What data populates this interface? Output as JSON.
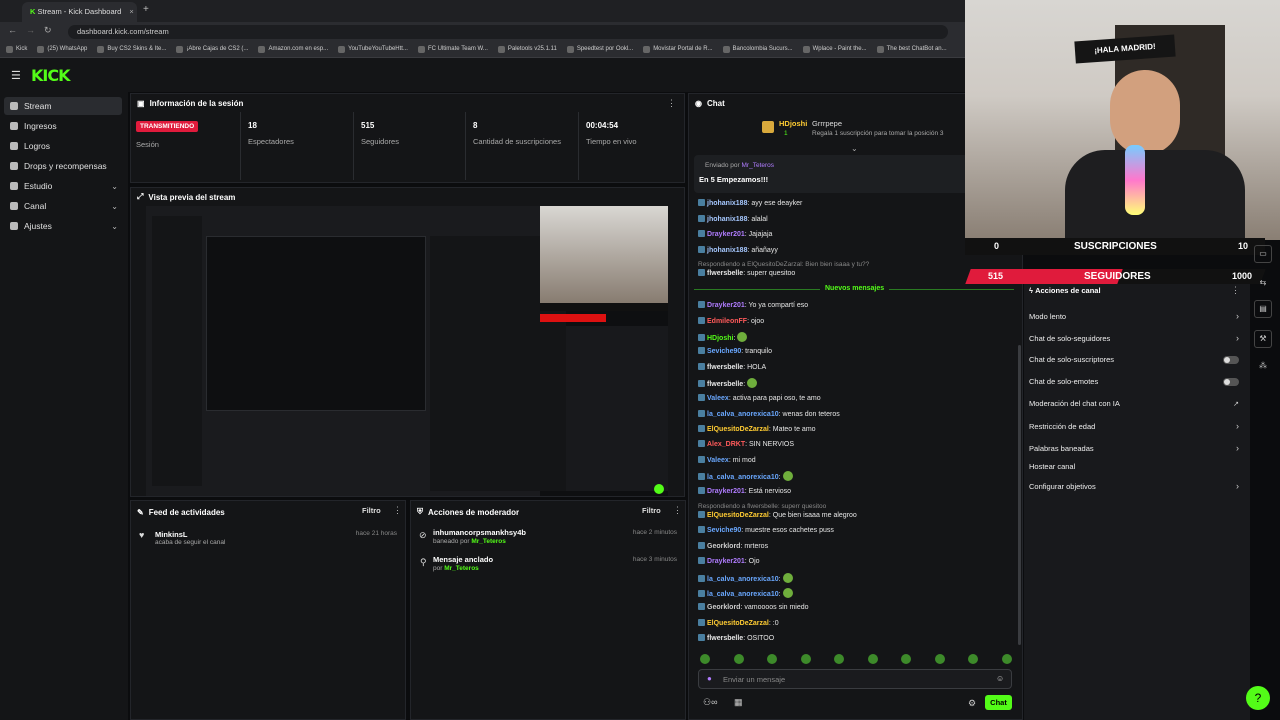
{
  "browser": {
    "tab_title": "Stream - Kick Dashboard",
    "url": "dashboard.kick.com/stream",
    "bookmarks": [
      "Kick",
      "(25) WhatsApp",
      "Buy CS2 Skins & Ite...",
      "¡Abre Cajas de CS2 (...",
      "Amazon.com en esp...",
      "YouTubeYouTubeHtt...",
      "FC Ultimate Team W...",
      "Paletools v25.1.11",
      "Speedtest por Ookl...",
      "Movistar Portal de R...",
      "Bancolombia Sucurs...",
      "Wplace - Paint the...",
      "The best ChatBot an..."
    ]
  },
  "logo": "KICK",
  "sidebar": [
    {
      "label": "Stream"
    },
    {
      "label": "Ingresos"
    },
    {
      "label": "Logros"
    },
    {
      "label": "Drops y recompensas"
    },
    {
      "label": "Estudio"
    },
    {
      "label": "Canal"
    },
    {
      "label": "Ajustes"
    }
  ],
  "session": {
    "title": "Información de la sesión",
    "live": "TRANSMITIENDO",
    "session_label": "Sesión",
    "stats": [
      {
        "value": "18",
        "label": "Espectadores"
      },
      {
        "value": "515",
        "label": "Seguidores"
      },
      {
        "value": "8",
        "label": "Cantidad de suscripciones"
      },
      {
        "value": "00:04:54",
        "label": "Tiempo en vivo"
      }
    ]
  },
  "preview": {
    "title": "Vista previa del stream"
  },
  "feed": {
    "title": "Feed de actividades",
    "filter": "Filtro",
    "user": "MinkinsL",
    "action": "acaba de seguir el canal",
    "time": "hace 21 horas"
  },
  "mod": {
    "title": "Acciones de moderador",
    "filter": "Filtro",
    "items": [
      {
        "title": "inhumancorpsmankhsy4b",
        "sub": "baneado por",
        "by": "Mr_Teteros",
        "time": "hace 2 minutos"
      },
      {
        "title": "Mensaje anclado",
        "sub": "por",
        "by": "Mr_Teteros",
        "time": "hace 3 minutos"
      }
    ]
  },
  "chat": {
    "title": "Chat",
    "top_user": "HDjoshi",
    "top_user2": "Grrrpepe",
    "top_count": "1",
    "sub_note": "Regala 1 suscripción para tomar la posición 3",
    "pinned_by": "Enviado por",
    "pinned_user": "Mr_Teteros",
    "pinned_msg": "En 5 Empezamos!!!",
    "new_divider": "Nuevos mensajes",
    "input_placeholder": "Enviar un mensaje",
    "send": "Chat",
    "messages": [
      {
        "user": "jhohanix188",
        "text": "ayy ese deayker",
        "color": "#a6c8ff"
      },
      {
        "user": "jhohanix188",
        "text": "alalal",
        "color": "#a6c8ff"
      },
      {
        "user": "Drayker201",
        "text": "Jajajaja",
        "color": "#b07cff"
      },
      {
        "user": "jhohanix188",
        "text": "añañayy",
        "color": "#a6c8ff"
      },
      {
        "user": "",
        "text": "Respondiendo a ElQuesitoDeZarzal: Bien bien isaaa y tu??",
        "color": "#888"
      },
      {
        "user": "flwersbelle",
        "text": "superr quesitoo",
        "color": "#e6e6e6"
      },
      {
        "user": "Drayker201",
        "text": "Yo ya compartí eso",
        "color": "#b07cff"
      },
      {
        "user": "EdmileonFF",
        "text": "ojoo",
        "color": "#ff5a5a"
      },
      {
        "user": "HDjoshi",
        "text": "",
        "color": "#53fc18"
      },
      {
        "user": "Seviche90",
        "text": "tranquilo",
        "color": "#6aa8ff"
      },
      {
        "user": "flwersbelle",
        "text": "HOLA",
        "color": "#e6e6e6"
      },
      {
        "user": "flwersbelle",
        "text": "",
        "color": "#e6e6e6"
      },
      {
        "user": "Valeex",
        "text": "activa para papi oso, te amo",
        "color": "#6aa8ff"
      },
      {
        "user": "la_calva_anorexica10",
        "text": "wenas don teteros",
        "color": "#6aa8ff"
      },
      {
        "user": "ElQuesitoDeZarzal",
        "text": "Mateo te amo",
        "color": "#ffcc33"
      },
      {
        "user": "Alex_DRKT",
        "text": "SIN NERVIOS",
        "color": "#ff5a5a"
      },
      {
        "user": "Valeex",
        "text": "mi mod",
        "color": "#6aa8ff"
      },
      {
        "user": "la_calva_anorexica10",
        "text": "",
        "color": "#6aa8ff"
      },
      {
        "user": "Drayker201",
        "text": "Está nervioso",
        "color": "#b07cff"
      },
      {
        "user": "",
        "text": "Respondiendo a flwersbelle: superr quesitoo",
        "color": "#888"
      },
      {
        "user": "ElQuesitoDeZarzal",
        "text": "Que bien isaaa me alegroo",
        "color": "#ffcc33"
      },
      {
        "user": "Seviche90",
        "text": "muestre esos cachetes puss",
        "color": "#6aa8ff"
      },
      {
        "user": "Georklord",
        "text": "mrteros",
        "color": "#ccc"
      },
      {
        "user": "Drayker201",
        "text": "Ojo",
        "color": "#b07cff"
      },
      {
        "user": "la_calva_anorexica10",
        "text": "",
        "color": "#6aa8ff"
      },
      {
        "user": "la_calva_anorexica10",
        "text": "",
        "color": "#6aa8ff"
      },
      {
        "user": "Georklord",
        "text": "vamoooos sin miedo",
        "color": "#ccc"
      },
      {
        "user": "ElQuesitoDeZarzal",
        "text": ":0",
        "color": "#ffcc33"
      },
      {
        "user": "flwersbelle",
        "text": "OSITOO",
        "color": "#e6e6e6"
      }
    ]
  },
  "overlay": {
    "subs_label": "SUSCRIPCIONES",
    "subs_value": "0",
    "subs_goal": "10",
    "subs_progress": 0,
    "followers_label": "SEGUIDORES",
    "followers_value": "515",
    "followers_goal": "1000",
    "followers_progress": 0.515
  },
  "actions": {
    "title": "Acciones de canal",
    "rows": [
      {
        "label": "Modo lento",
        "type": "chev"
      },
      {
        "label": "Chat de solo-seguidores",
        "type": "chev"
      },
      {
        "label": "Chat de solo-suscriptores",
        "type": "toggle"
      },
      {
        "label": "Chat de solo-emotes",
        "type": "toggle"
      },
      {
        "label": "Moderación del chat con IA",
        "type": "ext"
      },
      {
        "label": "Restricción de edad",
        "type": "chev"
      },
      {
        "label": "Palabras baneadas",
        "type": "chev"
      },
      {
        "label": "Hostear canal",
        "type": "none"
      },
      {
        "label": "Configurar objetivos",
        "type": "chev"
      }
    ]
  },
  "colors": {
    "accent": "#53fc18",
    "live": "#e01b3c",
    "bg": "#0b0c0e",
    "panel": "#141517"
  }
}
